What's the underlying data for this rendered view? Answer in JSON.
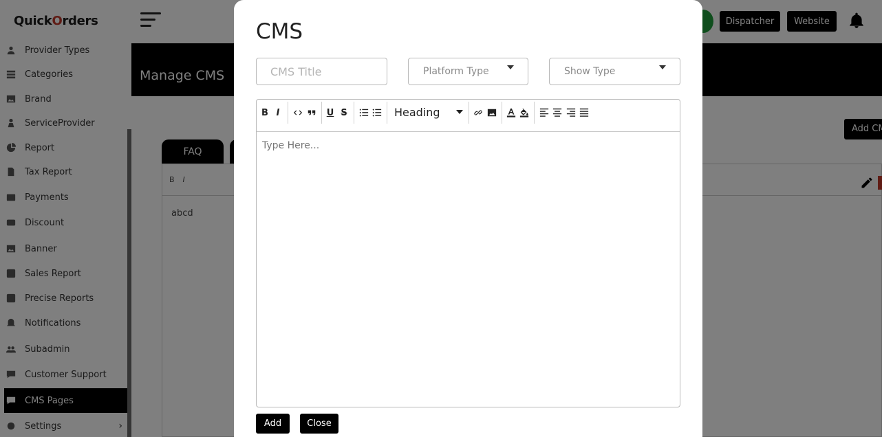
{
  "brand": {
    "logo_left": "Quick",
    "logo_accent": "O",
    "logo_right": "rders"
  },
  "sidebar": {
    "items": [
      {
        "label": "Provider Types",
        "icon": "users-icon"
      },
      {
        "label": "Categories",
        "icon": "list-icon"
      },
      {
        "label": "Brand",
        "icon": "image-icon"
      },
      {
        "label": "ServiceProvider",
        "icon": "person-icon"
      },
      {
        "label": "Report",
        "icon": "chart-icon"
      },
      {
        "label": "Tax Report",
        "icon": "document-icon"
      },
      {
        "label": "Payments",
        "icon": "wallet-icon"
      },
      {
        "label": "Discount",
        "icon": "tag-icon"
      },
      {
        "label": "Banner",
        "icon": "picture-icon"
      },
      {
        "label": "Sales Report",
        "icon": "sales-icon"
      },
      {
        "label": "Precise Reports",
        "icon": "report-icon"
      },
      {
        "label": "Notifications",
        "icon": "bell-icon"
      },
      {
        "label": "Subadmin",
        "icon": "group-icon"
      },
      {
        "label": "Customer Support",
        "icon": "chat-icon"
      },
      {
        "label": "CMS Pages",
        "icon": "cms-icon"
      },
      {
        "label": "Settings",
        "icon": "gear-icon"
      }
    ],
    "settings_chevron": "›"
  },
  "topbar": {
    "dispatcher_label": "Dispatcher",
    "website_label": "Website"
  },
  "page": {
    "title": "Manage CMS",
    "add_button": "Add CMS",
    "tab_faq": "FAQ",
    "content_preview": "abcd"
  },
  "modal": {
    "title": "CMS",
    "cms_title_placeholder": "CMS Title",
    "platform_type_label": "Platform Type",
    "show_type_label": "Show Type",
    "editor": {
      "toolbar": {
        "bold": "B",
        "italic": "I",
        "underline": "U",
        "strike": "S",
        "heading": "Heading"
      },
      "placeholder": "Type Here..."
    },
    "add_label": "Add",
    "close_label": "Close"
  },
  "bg_toolbar": {
    "bold": "B",
    "italic": "I"
  }
}
